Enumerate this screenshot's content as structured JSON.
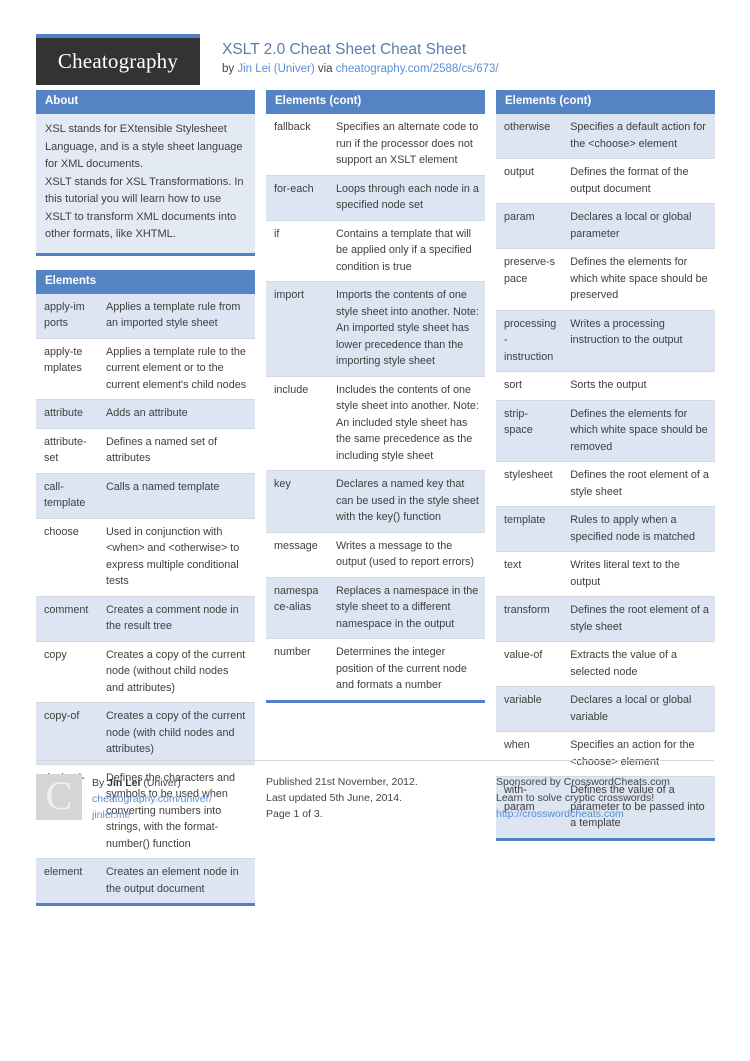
{
  "header": {
    "logo_text": "Cheatography",
    "title": "XSLT 2.0 Cheat Sheet Cheat Sheet",
    "by_prefix": "by ",
    "author": "Jin Lei (Univer)",
    "via": " via ",
    "source_url": "cheatography.com/2588/cs/673/"
  },
  "blocks": {
    "about": {
      "title": "About",
      "paragraphs": [
        "XSL stands for EXtensible Stylesheet Language, and is a style sheet language for XML documents.",
        "XSLT stands for XSL Transformations. In this tutorial you will learn how to use XSLT to transform XML documents into other formats, like XHTML."
      ]
    },
    "elements": {
      "title": "Elements",
      "rows": [
        {
          "name": "apply-im ports",
          "desc": "Applies a template rule from an imported style sheet"
        },
        {
          "name": "apply-te mplates",
          "desc": "Applies a template rule to the current element or to the current element's child nodes"
        },
        {
          "name": "attribute",
          "desc": "Adds an attribute"
        },
        {
          "name": "attribute-set",
          "desc": "Defines a named set of attributes"
        },
        {
          "name": "call-template",
          "desc": "Calls a named template"
        },
        {
          "name": "choose",
          "desc": "Used in conjunction with <when> and <otherwise> to express multiple conditional tests"
        },
        {
          "name": "comment",
          "desc": "Creates a comment node in the result tree"
        },
        {
          "name": "copy",
          "desc": "Creates a copy of the current node (without child nodes and attributes)"
        },
        {
          "name": "copy-of",
          "desc": "Creates a copy of the current node (with child nodes and attributes)"
        },
        {
          "name": "decimal-format",
          "desc": "Defines the characters and symbols to be used when converting numbers into strings, with the format-number() function"
        },
        {
          "name": "element",
          "desc": "Creates an element node in the output document"
        }
      ]
    },
    "elements_cont_2": {
      "title": "Elements (cont)",
      "rows": [
        {
          "name": "fallback",
          "desc": "Specifies an alternate code to run if the processor does not support an XSLT element"
        },
        {
          "name": "for-each",
          "desc": "Loops through each node in a specified node set"
        },
        {
          "name": "if",
          "desc": "Contains a template that will be applied only if a specified condition is true"
        },
        {
          "name": "import",
          "desc": "Imports the contents of one style sheet into another. Note: An imported style sheet has lower precedence than the importing style sheet"
        },
        {
          "name": "include",
          "desc": "Includes the contents of one style sheet into another. Note: An included style sheet has the same precedence as the including style sheet"
        },
        {
          "name": "key",
          "desc": "Declares a named key that can be used in the style sheet with the key() function"
        },
        {
          "name": "message",
          "desc": "Writes a message to the output (used to report errors)"
        },
        {
          "name": "namespa ce-alias",
          "desc": "Replaces a namespace in the style sheet to a different namespace in the output"
        },
        {
          "name": "number",
          "desc": "Determines the integer position of the current node and formats a number"
        }
      ]
    },
    "elements_cont_3": {
      "title": "Elements (cont)",
      "rows": [
        {
          "name": "otherwise",
          "desc": "Specifies a default action for the <choose> element"
        },
        {
          "name": "output",
          "desc": "Defines the format of the output document"
        },
        {
          "name": "param",
          "desc": "Declares a local or global parameter"
        },
        {
          "name": "preserve-s pace",
          "desc": "Defines the elements for which white space should be preserved"
        },
        {
          "name": "processing - instruction",
          "desc": "Writes a processing instruction to the output"
        },
        {
          "name": "sort",
          "desc": "Sorts the output"
        },
        {
          "name": "strip-space",
          "desc": "Defines the elements for which white space should be removed"
        },
        {
          "name": "stylesheet",
          "desc": "Defines the root element of a style sheet"
        },
        {
          "name": "template",
          "desc": "Rules to apply when a specified node is matched"
        },
        {
          "name": "text",
          "desc": "Writes literal text to the output"
        },
        {
          "name": "transform",
          "desc": "Defines the root element of a style sheet"
        },
        {
          "name": "value-of",
          "desc": "Extracts the value of a selected node"
        },
        {
          "name": "variable",
          "desc": "Declares a local or global variable"
        },
        {
          "name": "when",
          "desc": "Specifies an action for the <choose> element"
        },
        {
          "name": "with-param",
          "desc": "Defines the value of a parameter to be passed into a template"
        }
      ]
    }
  },
  "footer": {
    "avatar_letter": "C",
    "by_label": "By ",
    "author_name": "Jin Lei",
    "author_suffix": " (Univer)",
    "profile_url": "cheatography.com/univer/",
    "personal_url": "jinlei.me",
    "published": "Published 21st November, 2012.",
    "updated": "Last updated 5th June, 2014.",
    "page": "Page 1 of 3.",
    "sponsor_prefix": "Sponsored by ",
    "sponsor_name": "CrosswordCheats.com",
    "sponsor_tagline": "Learn to solve cryptic crosswords!",
    "sponsor_url": "http://crosswordcheats.com"
  },
  "colors": {
    "header_blue": "#5484c4",
    "accent_rule": "#4f81c4",
    "row_alt": "#dce5f1",
    "about_bg": "#e3eaf4",
    "link": "#5b8fd4",
    "title": "#5c7cab"
  }
}
